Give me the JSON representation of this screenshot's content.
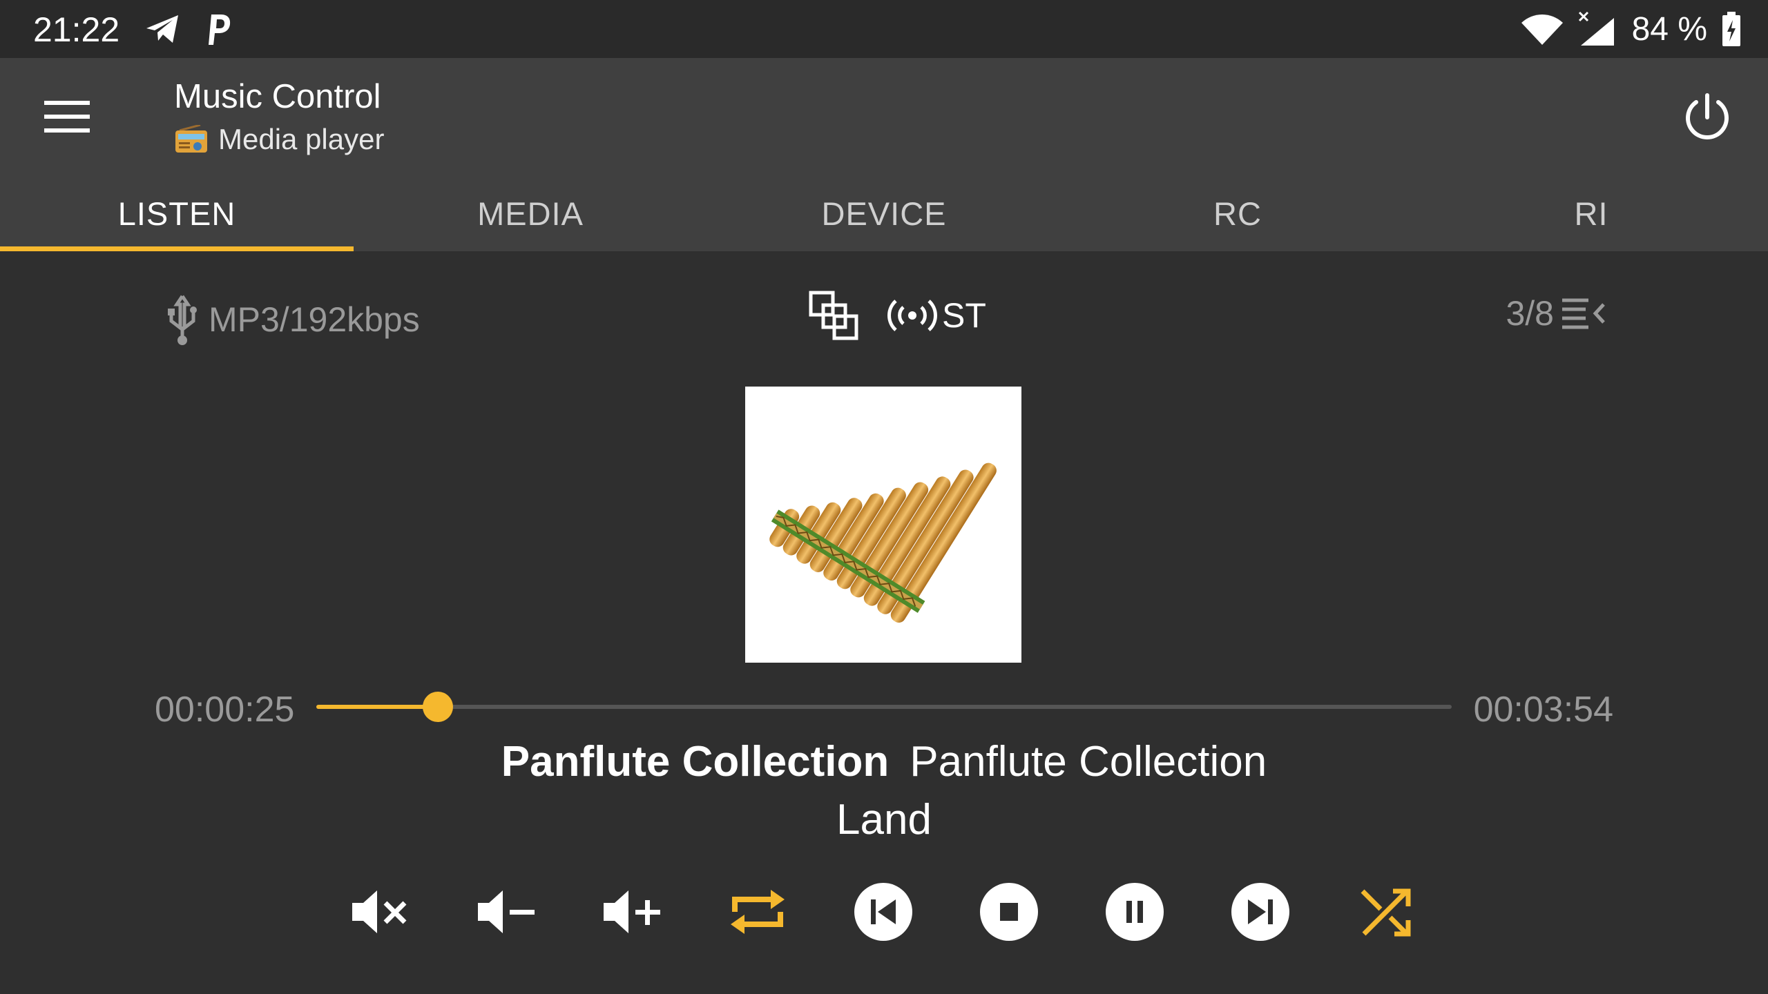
{
  "status_bar": {
    "time": "21:22",
    "left_icons": [
      "telegram-icon",
      "p-app-icon"
    ],
    "right_icons": [
      "wifi-icon",
      "cell-signal-icon",
      "battery-charging-icon"
    ],
    "battery": "84 %"
  },
  "toolbar": {
    "title": "Music Control",
    "subtitle": "Media player",
    "subtitle_icon": "radio-icon",
    "menu_icon": "hamburger-menu-icon",
    "power_icon": "power-icon"
  },
  "tabs": [
    {
      "label": "LISTEN",
      "active": true
    },
    {
      "label": "MEDIA",
      "active": false
    },
    {
      "label": "DEVICE",
      "active": false
    },
    {
      "label": "RC",
      "active": false
    },
    {
      "label": "RI",
      "active": false
    }
  ],
  "info": {
    "source_icon": "usb-icon",
    "format": "MP3/192kbps",
    "center_icon": "dsp-grid-icon",
    "broadcast_icon": "broadcast-icon",
    "stereo": "ST",
    "track_position": "3/8",
    "queue_icon": "playlist-icon"
  },
  "player": {
    "elapsed": "00:00:25",
    "total": "00:03:54",
    "progress": 0.107,
    "album": "Panflute Collection",
    "artist": "Panflute Collection",
    "title": "Land",
    "album_art": "panflute-image"
  },
  "controls": [
    {
      "name": "mute-icon"
    },
    {
      "name": "volume-down-icon"
    },
    {
      "name": "volume-up-icon"
    },
    {
      "name": "repeat-icon",
      "active": true
    },
    {
      "name": "previous-icon"
    },
    {
      "name": "stop-icon"
    },
    {
      "name": "pause-icon"
    },
    {
      "name": "next-icon"
    },
    {
      "name": "shuffle-icon",
      "active": true
    }
  ],
  "colors": {
    "accent": "#f5b82e",
    "background": "#2f2f2f",
    "toolbar": "#404040",
    "muted_text": "#9a9a9a"
  }
}
